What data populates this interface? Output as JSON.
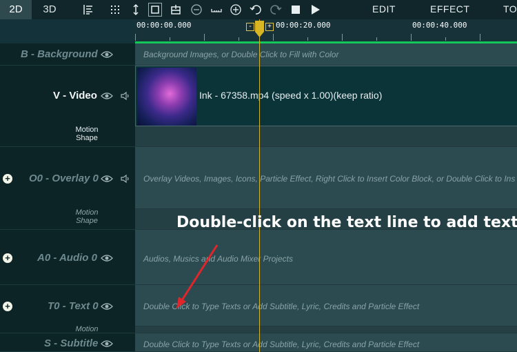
{
  "toolbar": {
    "tab_2d": "2D",
    "tab_3d": "3D",
    "menus": [
      "EDIT",
      "EFFECT",
      "TO"
    ],
    "icons": [
      "align-icon",
      "grid-icon",
      "vertical-resize-icon",
      "crop-icon",
      "snapshot-icon",
      "zoom-out-icon",
      "fit-icon",
      "zoom-in-icon",
      "undo-icon",
      "redo-icon",
      "stop-icon",
      "play-icon"
    ]
  },
  "ruler": {
    "labels": [
      "00:00:00.000",
      "00:00:20.000",
      "00:00:40.000"
    ],
    "minus": "-",
    "plus": "+"
  },
  "tracks": {
    "background": {
      "title": "B - Background",
      "hint": "Background Images, or Double Click to Fill with Color"
    },
    "video": {
      "title": "V - Video",
      "sub": "Motion Shape",
      "clip": "Ink - 67358.mp4  (speed x 1.00)(keep ratio)"
    },
    "overlay": {
      "title": "O0 - Overlay 0",
      "sub": "Motion Shape",
      "hint": "Overlay Videos, Images, Icons, Particle Effect, Right Click to Insert Color Block, or Double  Click to Ins"
    },
    "audio": {
      "title": "A0 - Audio 0",
      "hint": "Audios, Musics and Audio Mixer Projects"
    },
    "text": {
      "title": "T0 - Text 0",
      "sub": "Motion",
      "hint": "Double Click to Type Texts or Add Subtitle, Lyric, Credits and Particle Effect"
    },
    "subtitle": {
      "title": "S - Subtitle",
      "hint": "Double Click to Type Texts or Add Subtitle, Lyric, Credits and Particle Effect"
    }
  },
  "annotation": "Double-click on the text line to add text",
  "colors": {
    "accent": "#14c85a",
    "playhead": "#d8b524",
    "arrow": "#e0262b"
  }
}
